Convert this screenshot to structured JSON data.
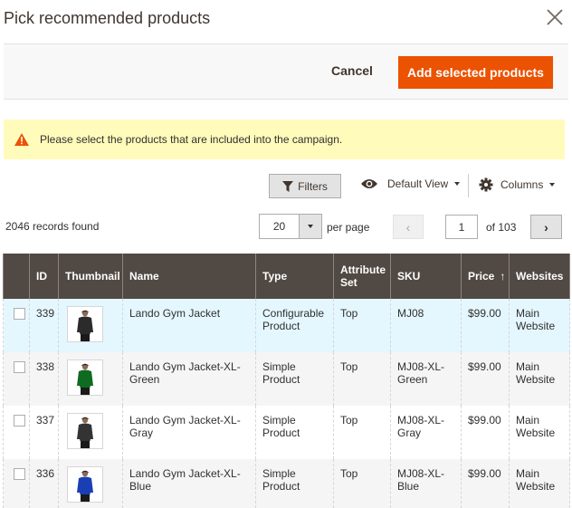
{
  "modal": {
    "title": "Pick recommended products",
    "close_icon": "close-icon"
  },
  "actions": {
    "cancel_label": "Cancel",
    "add_label": "Add selected products",
    "accent_color": "#eb5202"
  },
  "message": {
    "icon": "warning-icon",
    "text": "Please select the products that are included into the campaign."
  },
  "toolbar": {
    "filters_label": "Filters",
    "view_label": "Default View",
    "columns_label": "Columns"
  },
  "pagination": {
    "records_found": "2046 records found",
    "per_page_value": "20",
    "per_page_label": "per page",
    "current_page": "1",
    "page_total": "of 103",
    "prev_icon": "‹",
    "next_icon": "›"
  },
  "table": {
    "columns": [
      "",
      "ID",
      "Thumbnail",
      "Name",
      "Type",
      "Attribute Set",
      "SKU",
      "Price",
      "Websites"
    ],
    "sort_indicator": "↑",
    "rows": [
      {
        "id": "339",
        "name": "Lando Gym Jacket",
        "type": "Configurable Product",
        "attribute_set": "Top",
        "sku": "MJ08",
        "price": "$99.00",
        "websites": "Main Website",
        "jacket_color": "#2b2b2b"
      },
      {
        "id": "338",
        "name": "Lando Gym Jacket-XL-Green",
        "type": "Simple Product",
        "attribute_set": "Top",
        "sku": "MJ08-XL-Green",
        "price": "$99.00",
        "websites": "Main Website",
        "jacket_color": "#0f6b22"
      },
      {
        "id": "337",
        "name": "Lando Gym Jacket-XL-Gray",
        "type": "Simple Product",
        "attribute_set": "Top",
        "sku": "MJ08-XL-Gray",
        "price": "$99.00",
        "websites": "Main Website",
        "jacket_color": "#333333"
      },
      {
        "id": "336",
        "name": "Lando Gym Jacket-XL-Blue",
        "type": "Simple Product",
        "attribute_set": "Top",
        "sku": "MJ08-XL-Blue",
        "price": "$99.00",
        "websites": "Main Website",
        "jacket_color": "#1a3fb5"
      }
    ]
  }
}
